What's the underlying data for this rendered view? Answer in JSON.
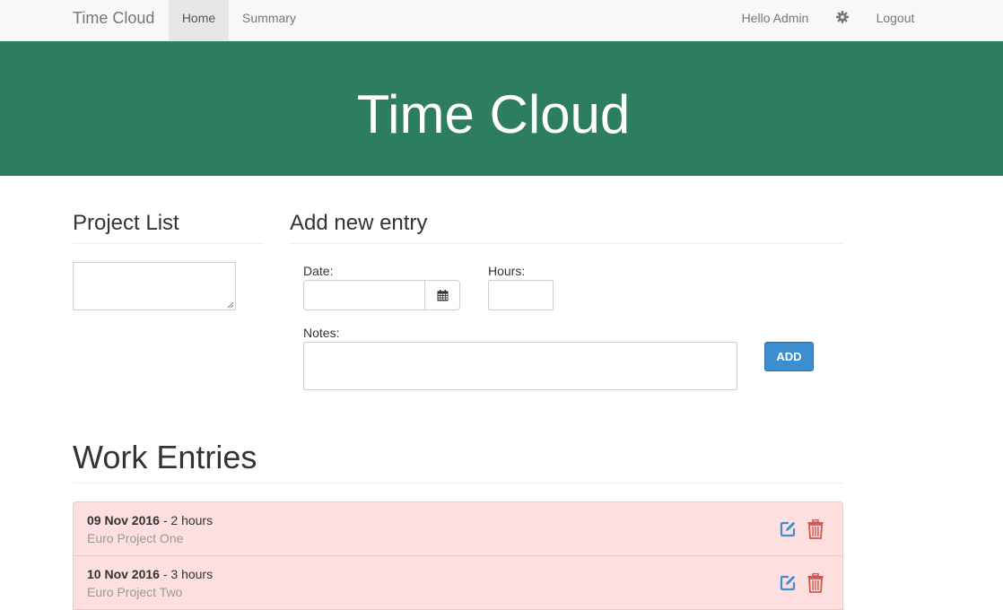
{
  "navbar": {
    "brand": "Time Cloud",
    "items": [
      {
        "label": "Home",
        "active": true
      },
      {
        "label": "Summary",
        "active": false
      }
    ],
    "greeting": "Hello Admin",
    "settings_icon": "gear-icon",
    "logout_label": "Logout"
  },
  "hero": {
    "title": "Time Cloud",
    "background_color": "#2d7e5c"
  },
  "project_list": {
    "title": "Project List"
  },
  "new_entry": {
    "title": "Add new entry",
    "date_label": "Date:",
    "date_value": "",
    "calendar_icon": "calendar-icon",
    "hours_label": "Hours:",
    "hours_value": "",
    "notes_label": "Notes:",
    "notes_value": "",
    "add_label": "ADD",
    "add_color": "#3c8ed0"
  },
  "work_entries": {
    "title": "Work Entries",
    "row_color": "#fddfdf",
    "edit_icon_color": "#3c8ed0",
    "delete_icon_color": "#d9534f",
    "items": [
      {
        "date": "09 Nov 2016",
        "hours": " - 2 hours",
        "project": "Euro Project One"
      },
      {
        "date": "10 Nov 2016",
        "hours": " - 3 hours",
        "project": "Euro Project Two"
      }
    ]
  }
}
